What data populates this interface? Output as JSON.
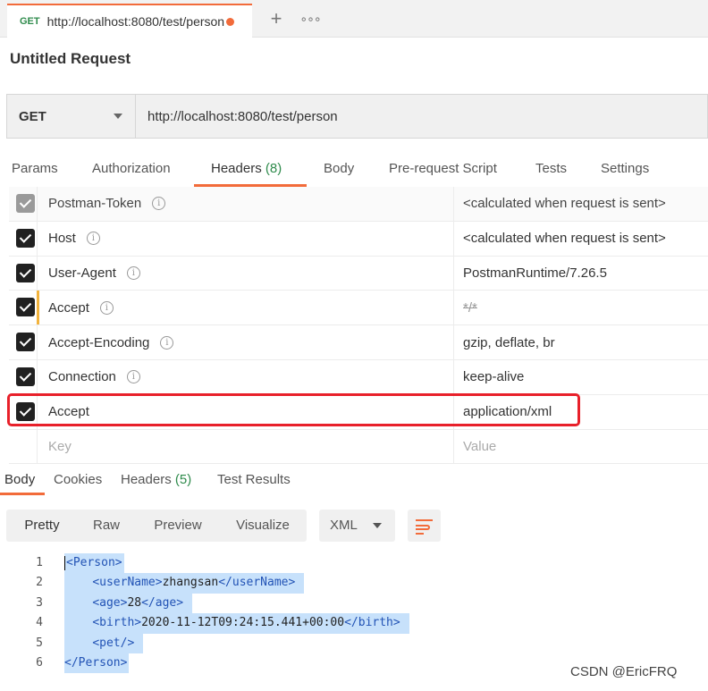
{
  "tab": {
    "method": "GET",
    "url": "http://localhost:8080/test/person"
  },
  "request_title": "Untitled Request",
  "request": {
    "method": "GET",
    "url": "http://localhost:8080/test/person"
  },
  "request_tabs": {
    "params": "Params",
    "authorization": "Authorization",
    "headers": "Headers",
    "headers_count": "(8)",
    "body": "Body",
    "prerequest": "Pre-request Script",
    "tests": "Tests",
    "settings": "Settings"
  },
  "headers": [
    {
      "key": "Postman-Token",
      "value": "<calculated when request is sent>"
    },
    {
      "key": "Host",
      "value": "<calculated when request is sent>"
    },
    {
      "key": "User-Agent",
      "value": "PostmanRuntime/7.26.5"
    },
    {
      "key": "Accept",
      "value": "*/*"
    },
    {
      "key": "Accept-Encoding",
      "value": "gzip, deflate, br"
    },
    {
      "key": "Connection",
      "value": "keep-alive"
    },
    {
      "key": "Accept",
      "value": "application/xml"
    }
  ],
  "new_header": {
    "key": "Key",
    "value": "Value"
  },
  "response_tabs": {
    "body": "Body",
    "cookies": "Cookies",
    "headers": "Headers",
    "headers_count": "(5)",
    "test_results": "Test Results"
  },
  "view_modes": {
    "pretty": "Pretty",
    "raw": "Raw",
    "preview": "Preview",
    "visualize": "Visualize"
  },
  "format": "XML",
  "code": {
    "line_numbers": [
      "1",
      "2",
      "3",
      "4",
      "5",
      "6"
    ],
    "l1": "<Person>",
    "l2_open": "<userName>",
    "l2_val": "zhangsan",
    "l2_close": "</userName>",
    "l3_open": "<age>",
    "l3_val": "28",
    "l3_close": "</age>",
    "l4_open": "<birth>",
    "l4_val": "2020-11-12T09:24:15.441+00:00",
    "l4_close": "</birth>",
    "l5": "<pet/>",
    "l6": "</Person>"
  },
  "watermark": "CSDN @EricFRQ",
  "colors": {
    "accent": "#f26b3a",
    "count_green": "#2f8b4c",
    "highlight": "#e8202a",
    "selection": "#c7e1fb"
  }
}
